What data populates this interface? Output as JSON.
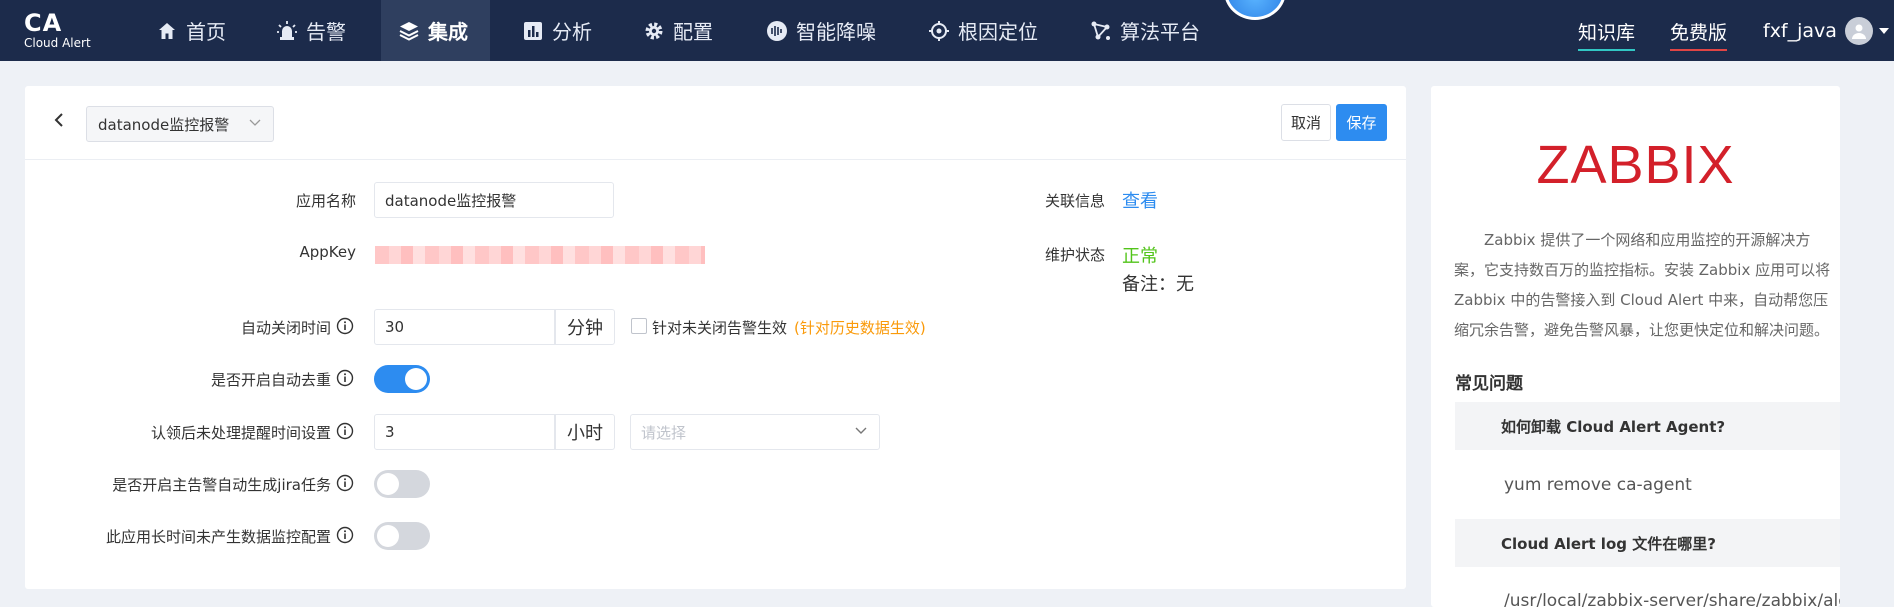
{
  "brand": {
    "logo": "CA",
    "subtitle": "Cloud Alert"
  },
  "nav": {
    "items": [
      {
        "label": "首页",
        "icon": "home-icon"
      },
      {
        "label": "告警",
        "icon": "alarm-icon"
      },
      {
        "label": "集成",
        "icon": "layers-icon",
        "active": true
      },
      {
        "label": "分析",
        "icon": "chart-icon"
      },
      {
        "label": "配置",
        "icon": "gear-icon"
      },
      {
        "label": "智能降噪",
        "icon": "noise-icon"
      },
      {
        "label": "根因定位",
        "icon": "target-icon"
      },
      {
        "label": "算法平台",
        "icon": "algorithm-icon"
      }
    ],
    "knowledge_base": "知识库",
    "free_edition": "免费版",
    "username": "fxf_java"
  },
  "header": {
    "app_select": "datanode监控报警",
    "cancel_label": "取消",
    "save_label": "保存"
  },
  "form": {
    "app_name_label": "应用名称",
    "app_name_value": "datanode监控报警",
    "appkey_label": "AppKey",
    "related_label": "关联信息",
    "related_link": "查看",
    "maint_label": "维护状态",
    "maint_status": "正常",
    "maint_note": "备注：无",
    "auto_close_label": "自动关闭时间",
    "auto_close_value": "30",
    "auto_close_unit": "分钟",
    "unclosed_checkbox": "针对未关闭告警生效",
    "history_note": "(针对历史数据生效)",
    "dedup_label": "是否开启自动去重",
    "dedup_on": true,
    "ack_reminder_label": "认领后未处理提醒时间设置",
    "ack_reminder_value": "3",
    "ack_reminder_unit": "小时",
    "ack_select_placeholder": "请选择",
    "jira_label": "是否开启主告警自动生成jira任务",
    "jira_on": false,
    "no_data_label": "此应用长时间未产生数据监控配置",
    "no_data_on": false
  },
  "side": {
    "logo_text": "ZABBIX",
    "description": "Zabbix 提供了一个网络和应用监控的开源解决方案，它支持数百万的监控指标。安装 Zabbix 应用可以将 Zabbix 中的告警接入到 Cloud Alert 中来，自动帮您压缩冗余告警，避免告警风暴，让您更快定位和解决问题。",
    "faq_title": "常见问题",
    "faqs": [
      {
        "q": "如何卸载 Cloud Alert Agent?",
        "a": "yum remove ca-agent"
      },
      {
        "q": "Cloud Alert log 文件在哪里?",
        "a": "/usr/local/zabbix-server/share/zabbix/ale"
      }
    ]
  },
  "colors": {
    "nav_bg": "#1c2b4b",
    "primary": "#2d8cf0",
    "success": "#52c41a",
    "warning": "#fa9a0a",
    "zabbix_red": "#d3202a"
  }
}
